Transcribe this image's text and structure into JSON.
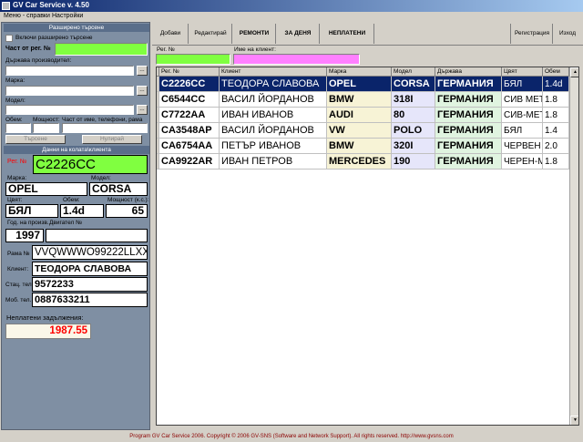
{
  "window": {
    "title": "GV Car Service v. 4.50"
  },
  "menu": {
    "items": [
      "Меню - справки",
      "Настройки"
    ]
  },
  "advanced_search": {
    "header": "Разширено търсене",
    "enable_label": "Включи разширено търсене",
    "part_of_reg_label": "Част от рег. №",
    "manufacturer_country_label": "Държава производител:",
    "make_label": "Марка:",
    "model_label": "Модел:",
    "volume_label": "Обем:",
    "power_label": "Мощност:",
    "part_name_label": "Част от име, телефони, рама",
    "search_button": "Търсене",
    "reset_button": "Нулирай"
  },
  "vehicle": {
    "header": "Данни на колата\\клиента",
    "reg_label": "Рег. №",
    "reg_value": "C2226CC",
    "make_label": "Марка:",
    "make_value": "OPEL",
    "model_label": "Модел:",
    "model_value": "CORSA",
    "color_label": "Цвят:",
    "color_value": "БЯЛ",
    "volume_label": "Обем:",
    "volume_value": "1.4d",
    "power_label": "Мощност (к.с.):",
    "power_value": "65",
    "year_label": "Год. на произв.",
    "year_value": "1997",
    "engine_label": "Двигател №",
    "engine_value": "",
    "frame_label": "Рама №",
    "frame_value": "VVQWWWO99222LLXX",
    "client_label": "Клиент:",
    "client_value": "ТЕОДОРА СЛАВОВА",
    "home_phone_label": "Стац. тел.",
    "home_phone_value": "9572233",
    "mobile_label": "Моб. тел.",
    "mobile_value": "0887633211",
    "unpaid_label": "Неплатени задължения:",
    "unpaid_value": "1987.55"
  },
  "toolbar": {
    "add": "Добави",
    "edit": "Редактирай",
    "repairs": "РЕМОНТИ",
    "daily": "ЗА ДЕНЯ",
    "unpaid": "НЕПЛАТЕНИ",
    "register": "Регистрация",
    "exit": "Изход"
  },
  "filters": {
    "reg_label": "Рег. №",
    "client_label": "Име на клиент:"
  },
  "table": {
    "columns": [
      "Рег. №",
      "Клиент",
      "Марка",
      "Модел",
      "Държава",
      "Цвят",
      "Обем"
    ],
    "rows": [
      [
        "C2226CC",
        "ТЕОДОРА СЛАВОВА",
        "OPEL",
        "CORSA",
        "ГЕРМАНИЯ",
        "БЯЛ",
        "1.4d"
      ],
      [
        "C6544CC",
        "ВАСИЛ ЙОРДАНОВ",
        "BMW",
        "318I",
        "ГЕРМАНИЯ",
        "СИВ МЕТ",
        "1.8"
      ],
      [
        "C7722AA",
        "ИВАН ИВАНОВ",
        "AUDI",
        "80",
        "ГЕРМАНИЯ",
        "СИВ-МЕТ",
        "1.8"
      ],
      [
        "CA3548AP",
        "ВАСИЛ ЙОРДАНОВ",
        "VW",
        "POLO",
        "ГЕРМАНИЯ",
        "БЯЛ",
        "1.4"
      ],
      [
        "CA6754AA",
        "ПЕТЪР ИВАНОВ",
        "BMW",
        "320I",
        "ГЕРМАНИЯ",
        "ЧЕРВЕН",
        "2.0"
      ],
      [
        "CA9922AR",
        "ИВАН ПЕТРОВ",
        "MERCEDES",
        "190",
        "ГЕРМАНИЯ",
        "ЧЕРЕН-М",
        "1.8"
      ]
    ],
    "selected_row": 0
  },
  "footer": {
    "text": "Program GV Car Service 2006. Copyright © 2006 GV-SNS (Software and Network Support). All rights reserved. http://www.gvsns.com"
  },
  "colors": {
    "green": "#80ff40",
    "pink": "#ff80ff",
    "selected": "#0a246a",
    "unpaid_text": "#ff0000",
    "reg_text": "#ff0000"
  }
}
